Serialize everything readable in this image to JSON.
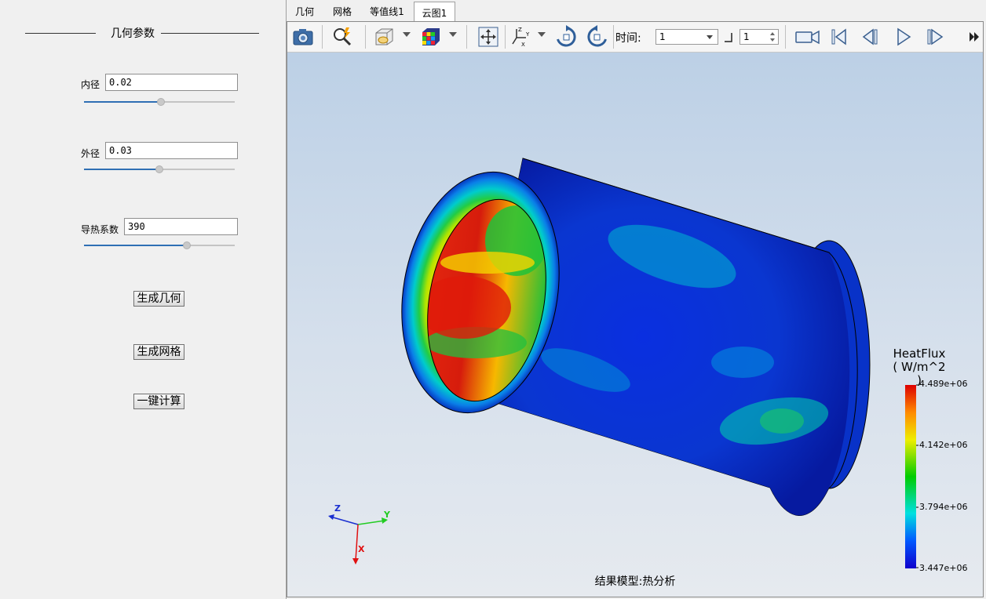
{
  "left_panel": {
    "group_title": "几何参数",
    "params": [
      {
        "label": "内径",
        "value": "0.02",
        "slider": 0.51
      },
      {
        "label": "外径",
        "value": "0.03",
        "slider": 0.5
      },
      {
        "label": "导热系数",
        "value": "390",
        "slider": 0.68
      }
    ],
    "buttons": {
      "generate_geometry": "生成几何",
      "generate_mesh": "生成网格",
      "compute": "一键计算"
    }
  },
  "tabs": [
    {
      "label": "几何",
      "active": false
    },
    {
      "label": "网格",
      "active": false
    },
    {
      "label": "等值线1",
      "active": false
    },
    {
      "label": "云图1",
      "active": true
    }
  ],
  "toolbar": {
    "icons": [
      "camera-icon",
      "zoom-icon",
      "display-mode-icon",
      "color-cube-icon",
      "fit-view-icon",
      "axes-icon",
      "rotate-cw-icon",
      "rotate-ccw-icon",
      "record-icon",
      "first-frame-icon",
      "prev-frame-icon",
      "play-icon",
      "next-frame-icon",
      "more-icon"
    ],
    "time_label": "时间:",
    "time_value": "1",
    "step_value": "1"
  },
  "viewport": {
    "result_label": "结果模型:热分析",
    "legend": {
      "title": "HeatFlux",
      "unit": "( W/m^2 )",
      "ticks": [
        "4.489e+06",
        "4.142e+06",
        "3.794e+06",
        "3.447e+06"
      ]
    },
    "axes": {
      "x": "X",
      "y": "Y",
      "z": "Z"
    }
  },
  "colors": {
    "accent": "#2f6fb4",
    "bg_top": "#bcd0e6",
    "bg_bottom": "#e6eaef",
    "colormap": [
      "#cc0000",
      "#ff8800",
      "#ffff00",
      "#00dd00",
      "#00dddd",
      "#0044ff",
      "#1a00cc"
    ]
  }
}
